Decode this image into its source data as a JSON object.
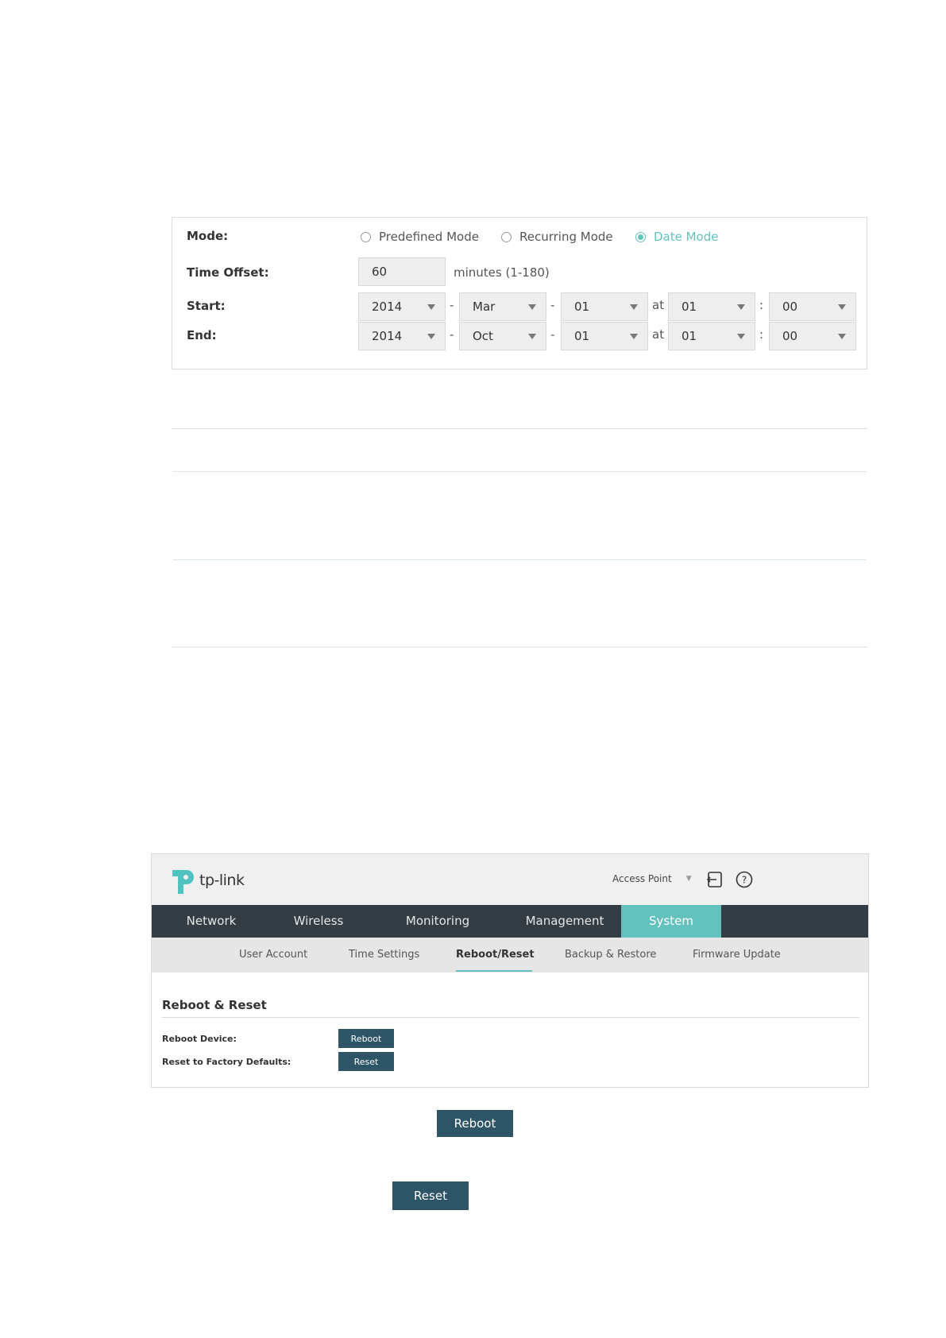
{
  "dst": {
    "mode_label": "Mode:",
    "modes": [
      {
        "label": "Predefined Mode",
        "selected": false
      },
      {
        "label": "Recurring Mode",
        "selected": false
      },
      {
        "label": "Date Mode",
        "selected": true
      }
    ],
    "time_offset_label": "Time Offset:",
    "time_offset_value": "60",
    "time_offset_unit": "minutes (1-180)",
    "start_label": "Start:",
    "end_label": "End:",
    "start": {
      "year": "2014",
      "month": "Mar",
      "day": "01",
      "hour": "01",
      "minute": "00"
    },
    "end": {
      "year": "2014",
      "month": "Oct",
      "day": "01",
      "hour": "01",
      "minute": "00"
    },
    "dash": "-",
    "at": "at",
    "colon": ":"
  },
  "tplink": {
    "logo_text": "tp-link",
    "mode_select": "Access Point",
    "nav": [
      "Network",
      "Wireless",
      "Monitoring",
      "Management",
      "System"
    ],
    "nav_active": "System",
    "subnav": [
      "User Account",
      "Time Settings",
      "Reboot/Reset",
      "Backup & Restore",
      "Firmware Update"
    ],
    "subnav_active": "Reboot/Reset",
    "section_title": "Reboot & Reset",
    "reboot_device_label": "Reboot Device:",
    "reboot_button": "Reboot",
    "reset_label": "Reset to Factory Defaults:",
    "reset_button": "Reset"
  },
  "buttons": {
    "reboot": "Reboot",
    "reset": "Reset"
  },
  "colors": {
    "accent": "#63c1be",
    "nav_bg": "#333d43",
    "button_bg": "#2d5567"
  }
}
